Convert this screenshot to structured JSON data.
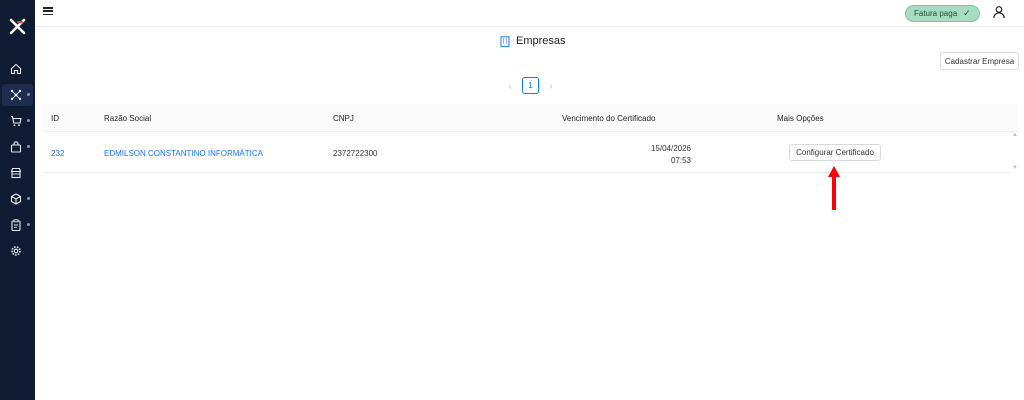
{
  "topbar": {
    "status_badge": "Fatura paga",
    "status_check": "✓"
  },
  "page": {
    "title": "Empresas",
    "register_button": "Cadastrar Empresa"
  },
  "pagination": {
    "current_page": "1",
    "prev": "‹",
    "next": "›"
  },
  "table": {
    "columns": [
      "ID",
      "Razão Social",
      "CNPJ",
      "Vencimento do Certificado",
      "Mais Opções"
    ],
    "rows": [
      {
        "id": "232",
        "razao_social": "EDMILSON CONSTANTINO INFORMÁTICA",
        "cnpj": "2372722300",
        "vencimento_date": "15/04/2026",
        "vencimento_time": "07:53",
        "action": "Configurar Certificado"
      }
    ]
  },
  "sidebar": {
    "items": [
      {
        "icon": "home-icon"
      },
      {
        "icon": "network-icon",
        "active": true
      },
      {
        "icon": "cart-icon"
      },
      {
        "icon": "bag-icon"
      },
      {
        "icon": "store-icon"
      },
      {
        "icon": "box-icon"
      },
      {
        "icon": "clipboard-icon"
      },
      {
        "icon": "gear-icon"
      }
    ]
  },
  "colors": {
    "sidebar_bg": "#0f1b33",
    "accent": "#1677ff",
    "badge_bg": "#a8dcc0",
    "annotation_arrow": "#ff0000"
  }
}
